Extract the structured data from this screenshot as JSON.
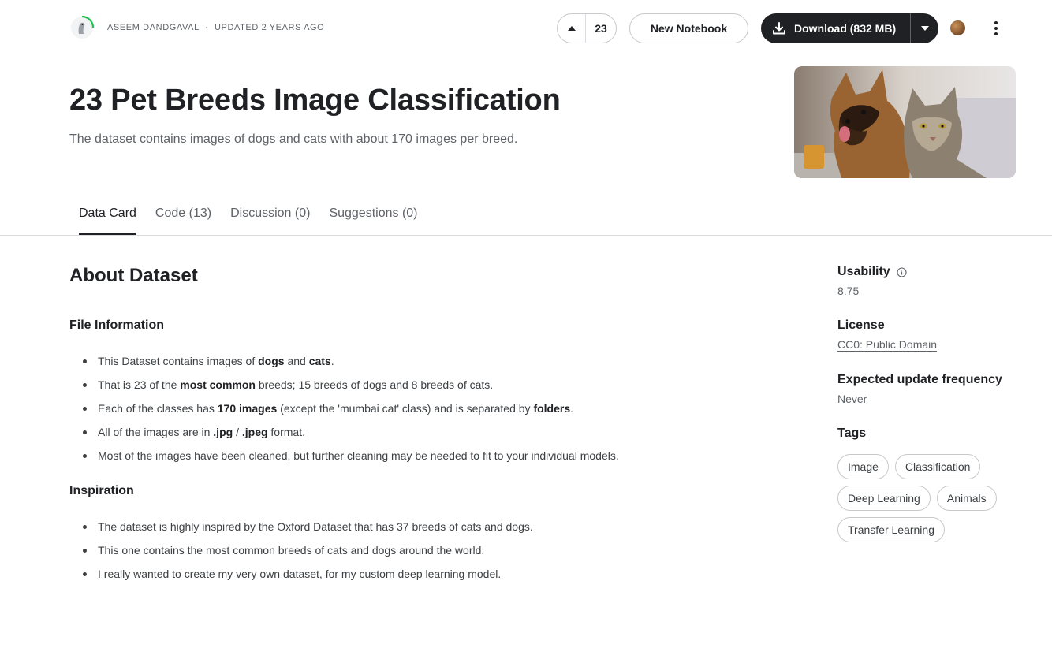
{
  "header": {
    "author": "ASEEM DANDGAVAL",
    "separator": "·",
    "updated": "UPDATED 2 YEARS AGO",
    "upvote_count": "23",
    "new_notebook_label": "New Notebook",
    "download_label": "Download (832 MB)"
  },
  "hero": {
    "title": "23 Pet Breeds Image Classification",
    "subtitle": "The dataset contains images of dogs and cats with about 170 images per breed."
  },
  "tabs": [
    {
      "label": "Data Card",
      "active": true
    },
    {
      "label": "Code (13)",
      "active": false
    },
    {
      "label": "Discussion (0)",
      "active": false
    },
    {
      "label": "Suggestions (0)",
      "active": false
    }
  ],
  "content": {
    "heading": "About Dataset",
    "file_info": {
      "heading": "File Information",
      "items": [
        [
          {
            "t": "This Dataset contains images of "
          },
          {
            "t": "dogs",
            "b": true
          },
          {
            "t": " and "
          },
          {
            "t": "cats",
            "b": true
          },
          {
            "t": "."
          }
        ],
        [
          {
            "t": "That is 23 of the "
          },
          {
            "t": "most common",
            "b": true
          },
          {
            "t": " breeds; 15 breeds of dogs and 8 breeds of cats."
          }
        ],
        [
          {
            "t": "Each of the classes has "
          },
          {
            "t": "170 images",
            "b": true
          },
          {
            "t": " (except the 'mumbai cat' class) and is separated by "
          },
          {
            "t": "folders",
            "b": true
          },
          {
            "t": "."
          }
        ],
        [
          {
            "t": "All of the images are in "
          },
          {
            "t": ".jpg",
            "b": true
          },
          {
            "t": " / "
          },
          {
            "t": ".jpeg",
            "b": true
          },
          {
            "t": " format."
          }
        ],
        [
          {
            "t": "Most of the images have been cleaned, but further cleaning may be needed to fit to your individual models."
          }
        ]
      ]
    },
    "inspiration": {
      "heading": "Inspiration",
      "items": [
        [
          {
            "t": "The dataset is highly inspired by the Oxford Dataset that has 37 breeds of cats and dogs."
          }
        ],
        [
          {
            "t": "This one contains the most common breeds of cats and dogs around the world."
          }
        ],
        [
          {
            "t": "I really wanted to create my very own dataset, for my custom deep learning model."
          }
        ]
      ]
    }
  },
  "sidebar": {
    "usability_label": "Usability",
    "usability_value": "8.75",
    "license_label": "License",
    "license_value": "CC0: Public Domain",
    "frequency_label": "Expected update frequency",
    "frequency_value": "Never",
    "tags_label": "Tags",
    "tags": [
      "Image",
      "Classification",
      "Deep Learning",
      "Animals",
      "Transfer Learning"
    ]
  },
  "colors": {
    "text_primary": "#202124",
    "text_secondary": "#5f6368",
    "button_dark": "#202124",
    "border": "#dadce0",
    "avatar_ring": "#20be4e"
  },
  "icons": [
    "kaggle-avatar-icon",
    "upvote-arrow-icon",
    "download-icon",
    "caret-down-icon",
    "user-avatar-icon",
    "more-vert-icon",
    "info-icon"
  ]
}
